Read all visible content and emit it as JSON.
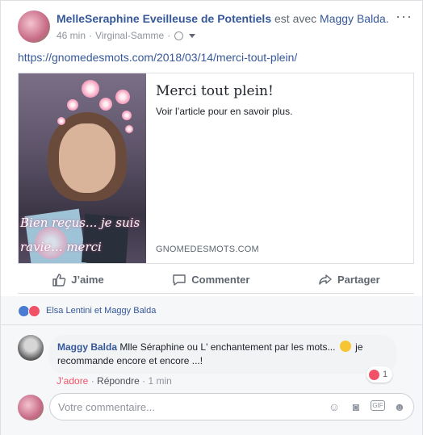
{
  "post": {
    "author": "MelleSeraphine Eveilleuse de Potentiels",
    "with_text": "est avec",
    "tagged": "Maggy Balda.",
    "time": "46 min",
    "sep": "·",
    "location": "Virginal-Samme",
    "sep2": "·",
    "link_text": "https://gnomedesmots.com/2018/03/14/merci-tout-plein/"
  },
  "preview": {
    "image_caption": "Bien reçus... je suis ravie... merci",
    "title": "Merci tout plein!",
    "description": "Voir l’article pour en savoir plus.",
    "domain": "GNOMEDESMOTS.COM"
  },
  "actions": {
    "like": "J’aime",
    "comment": "Commenter",
    "share": "Partager"
  },
  "reactions": {
    "names": "Elsa Lentini et Maggy Balda"
  },
  "comment": {
    "author": "Maggy Balda",
    "text_before": "Mlle Séraphine ou L' enchantement par les mots...",
    "text_after": "je recommande encore et encore ...!",
    "reaction_count": "1",
    "love_label": "J’adore",
    "sep": "·",
    "reply_label": "Répondre",
    "sep2": "·",
    "time": "1 min"
  },
  "composer": {
    "placeholder": "Votre commentaire..."
  },
  "colors": {
    "link": "#365899",
    "meta": "#90949c",
    "love": "#f25268",
    "like": "#4b7bd3"
  }
}
